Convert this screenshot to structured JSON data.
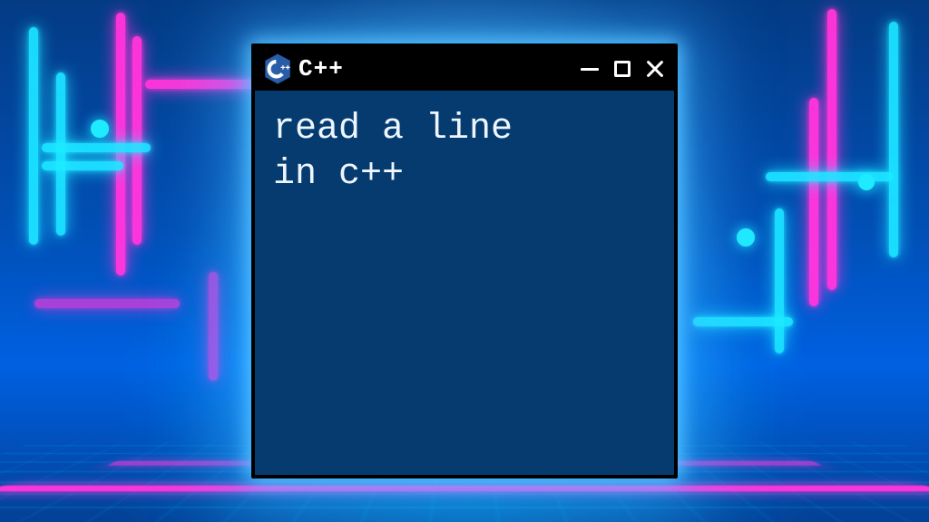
{
  "window": {
    "title": "C++",
    "icon_name": "cpp-logo-icon",
    "content_text": "read a line\nin c++"
  },
  "colors": {
    "window_bg": "#0b3a66",
    "titlebar_bg": "#000000",
    "text": "#eef5ff",
    "neon_cyan": "#33e6ff",
    "neon_pink": "#ff3bd2"
  }
}
